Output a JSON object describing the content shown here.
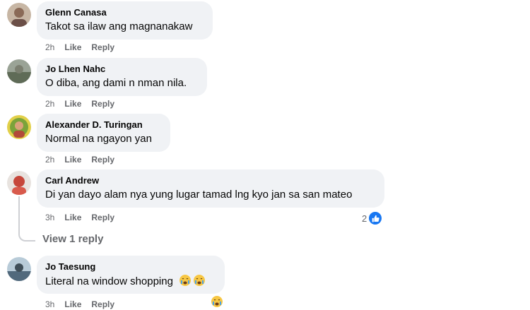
{
  "comments": [
    {
      "author": "Glenn Canasa",
      "text": "Takot sa ilaw ang magnanakaw",
      "time": "2h",
      "like": "Like",
      "reply": "Reply"
    },
    {
      "author": "Jo Lhen Nahc",
      "text": "O diba, ang dami n nman nila.",
      "time": "2h",
      "like": "Like",
      "reply": "Reply"
    },
    {
      "author": "Alexander D. Turingan",
      "text": "Normal na ngayon yan",
      "time": "2h",
      "like": "Like",
      "reply": "Reply"
    },
    {
      "author": "Carl Andrew",
      "text": "Di yan dayo alam nya yung lugar tamad lng kyo jan sa san mateo",
      "time": "3h",
      "like": "Like",
      "reply": "Reply",
      "reaction_count": "2",
      "reaction_icon": "like-icon"
    },
    {
      "author": "Jo Taesung",
      "text": "Literal na window shopping",
      "time": "3h",
      "like": "Like",
      "reply": "Reply",
      "text_emojis": [
        "crying-face-icon",
        "crying-face-icon"
      ],
      "reaction_icon": "crying-face-icon"
    }
  ],
  "view_replies": "View 1 reply",
  "colors": {
    "bubble": "#f0f2f5",
    "meta": "#65676b",
    "like_blue": "#1877f2",
    "thread": "#ced0d4"
  }
}
